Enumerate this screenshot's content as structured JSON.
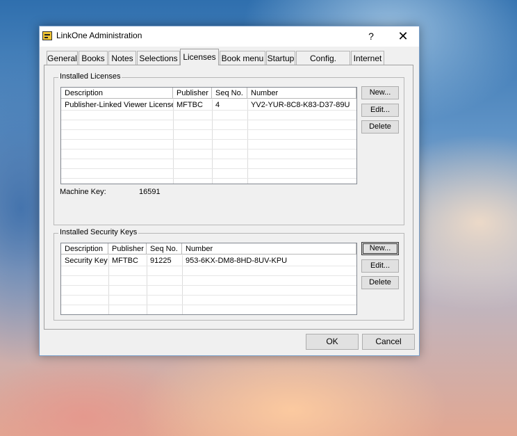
{
  "window": {
    "title": "LinkOne Administration",
    "help_label": "?",
    "close_label": "✕"
  },
  "tabs": [
    {
      "label": "General"
    },
    {
      "label": "Books"
    },
    {
      "label": "Notes"
    },
    {
      "label": "Selections"
    },
    {
      "label": "Licenses",
      "active": true
    },
    {
      "label": "Book menu"
    },
    {
      "label": "Startup"
    },
    {
      "label": "Config. Server"
    },
    {
      "label": "Internet"
    }
  ],
  "licenses": {
    "group_label": "Installed Licenses",
    "columns": [
      "Description",
      "Publisher",
      "Seq No.",
      "Number"
    ],
    "rows": [
      {
        "description": "Publisher-Linked Viewer License",
        "publisher": "MFTBC",
        "seq": "4",
        "number": "YV2-YUR-8C8-K83-D37-89U"
      }
    ],
    "buttons": {
      "new": "New...",
      "edit": "Edit...",
      "delete": "Delete"
    },
    "machine_key_label": "Machine Key:",
    "machine_key_value": "16591"
  },
  "security_keys": {
    "group_label": "Installed Security Keys",
    "columns": [
      "Description",
      "Publisher",
      "Seq No.",
      "Number"
    ],
    "rows": [
      {
        "description": "Security Key",
        "publisher": "MFTBC",
        "seq": "91225",
        "number": "953-6KX-DM8-8HD-8UV-KPU"
      }
    ],
    "buttons": {
      "new": "New...",
      "edit": "Edit...",
      "delete": "Delete"
    }
  },
  "footer": {
    "ok_label": "OK",
    "cancel_label": "Cancel"
  }
}
